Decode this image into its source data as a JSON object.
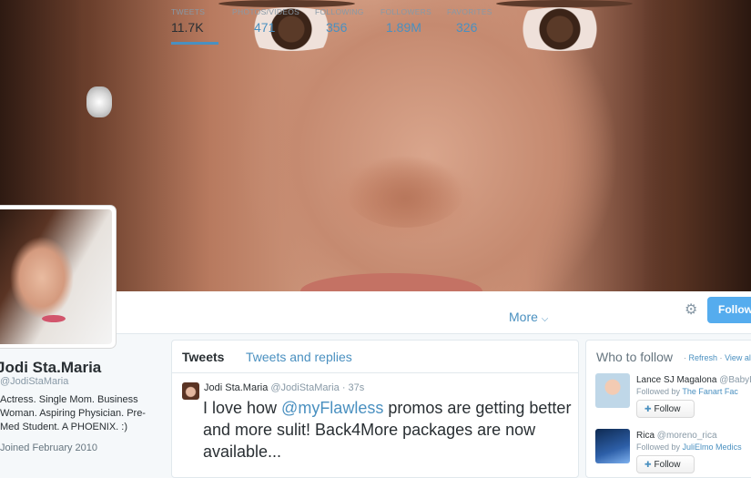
{
  "profile": {
    "name": "Jodi Sta.Maria",
    "handle": "@JodiStaMaria",
    "bio": "Actress. Single Mom. Business Woman. Aspiring Physician. Pre-Med Student. A PHOENIX. :)",
    "joined": "Joined February 2010"
  },
  "stats": [
    {
      "label": "TWEETS",
      "value": "11.7K"
    },
    {
      "label": "PHOTOS/VIDEOS",
      "value": "471"
    },
    {
      "label": "FOLLOWING",
      "value": "356"
    },
    {
      "label": "FOLLOWERS",
      "value": "1.89M"
    },
    {
      "label": "FAVORITES",
      "value": "326"
    }
  ],
  "nav": {
    "more_label": "More",
    "follow_label": "Follow"
  },
  "tabs": {
    "tweets": "Tweets",
    "replies": "Tweets and replies"
  },
  "tweet": {
    "name": "Jodi Sta.Maria",
    "handle": "@JodiStaMaria",
    "time": "37s",
    "text_before": "I love how ",
    "mention": "@myFlawless",
    "text_after": " promos are getting better and more sulit! Back4More packages are now available..."
  },
  "who_to_follow": {
    "title": "Who to follow",
    "refresh": "Refresh",
    "view_all": "View all",
    "suggestions": [
      {
        "name": "Lance SJ Magalona",
        "handle": "@BabyL",
        "followed_by_prefix": "Followed by",
        "followed_by": "The Fanart Fac",
        "button": "Follow"
      },
      {
        "name": "Rica",
        "handle": "@moreno_rica",
        "followed_by_prefix": "Followed by",
        "followed_by": "JuliElmo Medics",
        "button": "Follow"
      }
    ]
  },
  "icons": {
    "gear": "gear-icon",
    "chevron": "chevron-down-icon",
    "person_plus": "person-plus-icon"
  },
  "colors": {
    "accent": "#4a90c0",
    "follow_button": "#55acee"
  }
}
